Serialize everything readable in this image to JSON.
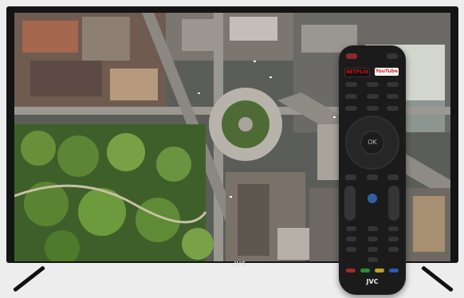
{
  "tv": {
    "brand": "JVC"
  },
  "remote": {
    "netflix_label": "NETFLIX",
    "youtube_label": "YouTube",
    "ok_label": "OK",
    "brand": "JVC"
  }
}
